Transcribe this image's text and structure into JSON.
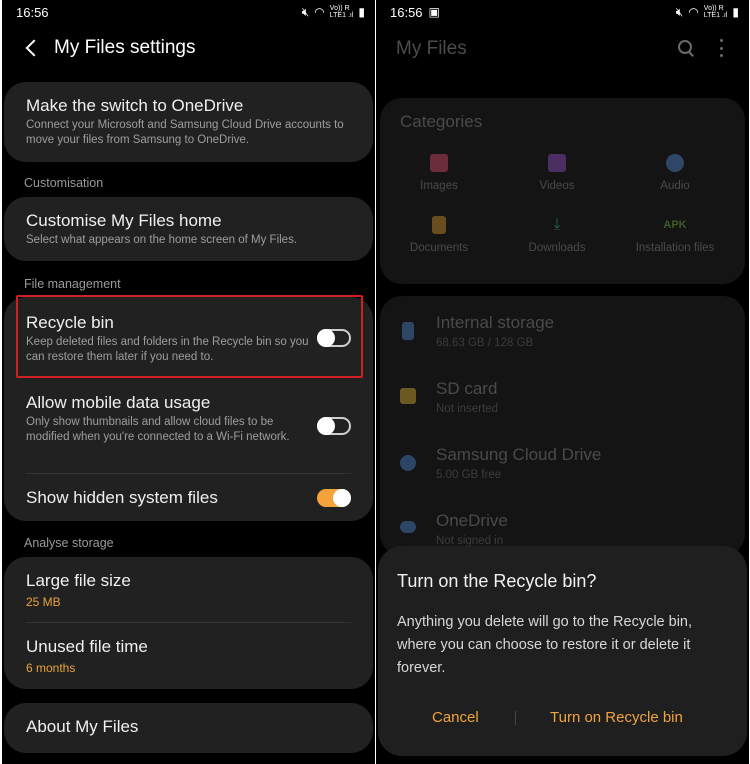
{
  "left_screen": {
    "status": {
      "time": "16:56",
      "icons": [
        "mute-icon",
        "wifi-icon",
        "signal-icon",
        "battery-icon"
      ],
      "net_small_top": "Vo)) R",
      "net_small_bottom": "LTE1 .ıl"
    },
    "header": {
      "title": "My Files settings"
    },
    "onedrive": {
      "title": "Make the switch to OneDrive",
      "subtitle": "Connect your Microsoft and Samsung Cloud Drive accounts to move your files from Samsung to OneDrive."
    },
    "section_customisation": "Customisation",
    "customise": {
      "title": "Customise My Files home",
      "subtitle": "Select what appears on the home screen of My Files."
    },
    "section_file_management": "File management",
    "recycle_bin": {
      "title": "Recycle bin",
      "subtitle": "Keep deleted files and folders in the Recycle bin so you can restore them later if you need to.",
      "enabled": false
    },
    "mobile_data": {
      "title": "Allow mobile data usage",
      "subtitle": "Only show thumbnails and allow cloud files to be modified when you're connected to a Wi-Fi network.",
      "enabled": false
    },
    "hidden_files": {
      "title": "Show hidden system files",
      "enabled": true
    },
    "section_analyse": "Analyse storage",
    "large_file": {
      "title": "Large file size",
      "value": "25 MB"
    },
    "unused_file": {
      "title": "Unused file time",
      "value": "6 months"
    },
    "about": {
      "title": "About My Files"
    }
  },
  "right_screen": {
    "status": {
      "time": "16:56",
      "net_small_top": "Vo)) R",
      "net_small_bottom": "LTE1 .ıl"
    },
    "header": {
      "title": "My Files"
    },
    "categories": {
      "title": "Categories",
      "items": [
        {
          "label": "Images",
          "icon": "image-icon",
          "color": "#6b2d3a"
        },
        {
          "label": "Videos",
          "icon": "video-icon",
          "color": "#4b2f63"
        },
        {
          "label": "Audio",
          "icon": "music-icon",
          "color": "#2f4666"
        },
        {
          "label": "Documents",
          "icon": "document-icon",
          "color": "#6a4d1f"
        },
        {
          "label": "Downloads",
          "icon": "download-icon",
          "color": "#2a5a53"
        },
        {
          "label": "Installation files",
          "icon": "apk-icon",
          "color": "#3d5a2a",
          "icon_text": "APK"
        }
      ]
    },
    "storage": [
      {
        "title": "Internal storage",
        "subtitle": "68.63 GB / 128 GB",
        "icon": "phone-storage-icon",
        "color": "#2d4666"
      },
      {
        "title": "SD card",
        "subtitle": "Not inserted",
        "icon": "sd-card-icon",
        "color": "#6a5a1f"
      },
      {
        "title": "Samsung Cloud Drive",
        "subtitle": "5.00 GB free",
        "icon": "cloud-icon",
        "color": "#2d4666"
      },
      {
        "title": "OneDrive",
        "subtitle": "Not signed in",
        "icon": "onedrive-icon",
        "color": "#2d4666"
      }
    ],
    "dialog": {
      "title": "Turn on the Recycle bin?",
      "body": "Anything you delete will go to the Recycle bin, where you can choose to restore it or delete it forever.",
      "cancel": "Cancel",
      "confirm": "Turn on Recycle bin"
    }
  },
  "colors": {
    "accent": "#f4a23a",
    "highlight": "#d02020",
    "card": "#212121"
  }
}
